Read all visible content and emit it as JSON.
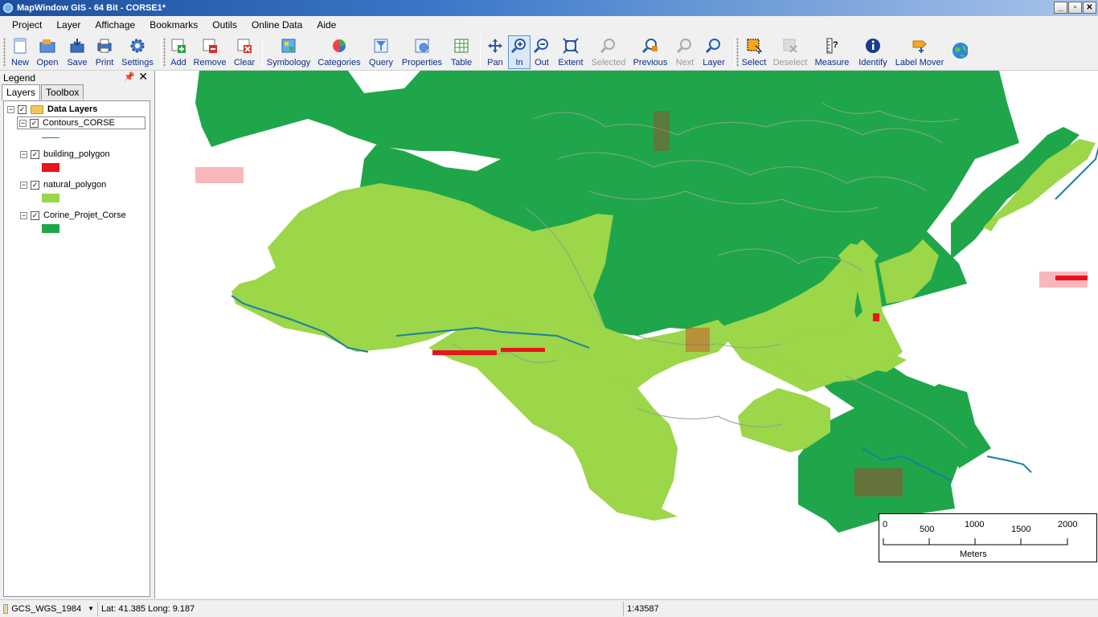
{
  "window": {
    "title": "MapWindow GIS - 64 Bit  - CORSE1*",
    "controls": [
      "_",
      "▫",
      "✕"
    ]
  },
  "menu": [
    "Project",
    "Layer",
    "Affichage",
    "Bookmarks",
    "Outils",
    "Online Data",
    "Aide"
  ],
  "toolbar": {
    "new": "New",
    "open": "Open",
    "save": "Save",
    "print": "Print",
    "settings": "Settings",
    "add": "Add",
    "remove": "Remove",
    "clear": "Clear",
    "symbology": "Symbology",
    "categories": "Categories",
    "query": "Query",
    "properties": "Properties",
    "table": "Table",
    "pan": "Pan",
    "in": "In",
    "out": "Out",
    "extent": "Extent",
    "selected": "Selected",
    "previous": "Previous",
    "next": "Next",
    "layer": "Layer",
    "select": "Select",
    "deselect": "Deselect",
    "measure": "Measure",
    "identify": "Identify",
    "label_mover": "Label Mover"
  },
  "legend": {
    "title": "Legend",
    "tabs": [
      "Layers",
      "Toolbox"
    ],
    "group": "Data Layers",
    "layers": [
      {
        "name": "Contours_CORSE",
        "color": "#1a7fa3"
      },
      {
        "name": "building_polygon",
        "color": "#e8141e"
      },
      {
        "name": "natural_polygon",
        "color": "#9cd649"
      },
      {
        "name": "Corine_Projet_Corse",
        "color": "#1fa64a"
      }
    ]
  },
  "map": {
    "colors": {
      "corine": "#1fa64a",
      "natural": "#9cd649",
      "building": "#e8141e",
      "contour": "#1a7fa3"
    }
  },
  "scalebar": {
    "ticks": [
      "0",
      "500",
      "1000",
      "1500",
      "2000"
    ],
    "unit": "Meters"
  },
  "status": {
    "projection": "GCS_WGS_1984",
    "coords": "Lat: 41.385 Long: 9.187",
    "scale": "1:43587"
  }
}
